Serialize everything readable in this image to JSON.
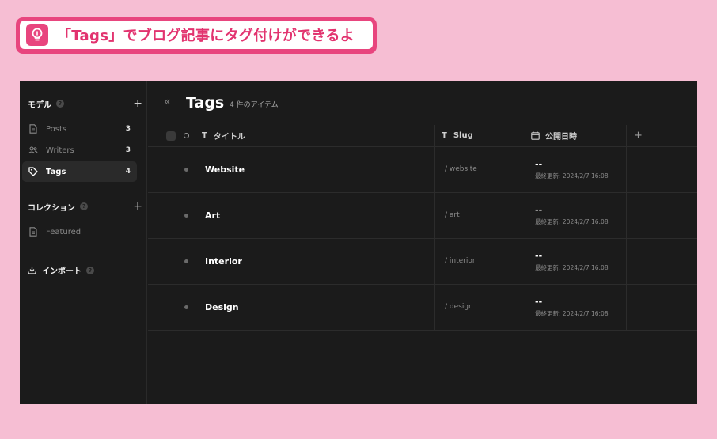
{
  "banner": {
    "text": "「Tags」でブログ記事にタグ付けができるよ",
    "icon": "lightbulb-icon",
    "accent": "#e8457e"
  },
  "sidebar": {
    "models_heading": "モデル",
    "models": [
      {
        "label": "Posts",
        "count": "3",
        "icon": "document-icon"
      },
      {
        "label": "Writers",
        "count": "3",
        "icon": "users-icon"
      },
      {
        "label": "Tags",
        "count": "4",
        "icon": "tag-icon",
        "active": true
      }
    ],
    "collections_heading": "コレクション",
    "collections": [
      {
        "label": "Featured",
        "icon": "document-icon"
      }
    ],
    "import_label": "インポート",
    "help_glyph": "?",
    "plus_glyph": "+"
  },
  "main": {
    "collapse_glyph": "«",
    "title": "Tags",
    "item_count": "4 件のアイテム",
    "columns": {
      "title": "タイトル",
      "slug": "Slug",
      "published": "公開日時",
      "add": "+"
    },
    "rows": [
      {
        "title": "Website",
        "slug": "/ website",
        "published": "--",
        "updated": "最終更新: 2024/2/7 16:08"
      },
      {
        "title": "Art",
        "slug": "/ art",
        "published": "--",
        "updated": "最終更新: 2024/2/7 16:08"
      },
      {
        "title": "Interior",
        "slug": "/ interior",
        "published": "--",
        "updated": "最終更新: 2024/2/7 16:08"
      },
      {
        "title": "Design",
        "slug": "/ design",
        "published": "--",
        "updated": "最終更新: 2024/2/7 16:08"
      }
    ]
  }
}
